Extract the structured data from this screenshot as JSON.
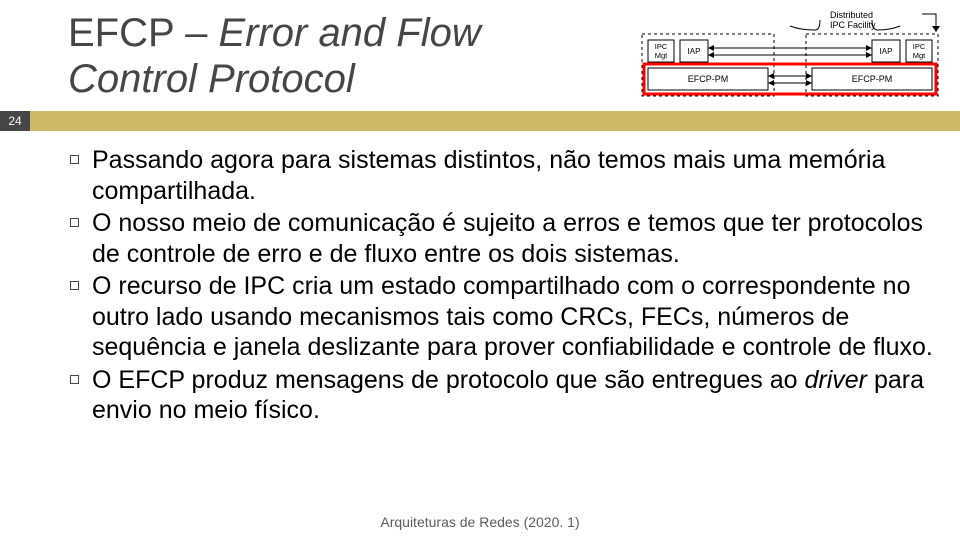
{
  "title": {
    "pre": "EFCP – ",
    "ital": "Error and Flow Control Protocol"
  },
  "pagenum": "24",
  "diagram": {
    "dist_label": "Distributed\nIPC Facility",
    "boxes": [
      "IPC\nMgt",
      "IAP",
      "EFCP-PM",
      "EFCP-PM",
      "IAP",
      "IPC\nMgt"
    ]
  },
  "bullets": [
    {
      "text": "Passando agora para sistemas distintos, não temos mais uma memória compartilhada."
    },
    {
      "text": "O nosso meio de comunicação é sujeito a erros e temos que ter protocolos de controle de erro e de fluxo entre os dois sistemas."
    },
    {
      "text": "O recurso de IPC cria um estado compartilhado com o correspondente no outro lado usando mecanismos tais como CRCs, FECs, números de sequência e janela deslizante para prover confiabilidade e controle de fluxo."
    },
    {
      "parts": [
        "O EFCP produz mensagens de protocolo que são entregues ao ",
        {
          "ital": "driver "
        },
        "para envio no meio físico."
      ]
    }
  ],
  "footer": "Arquiteturas de Redes (2020. 1)"
}
